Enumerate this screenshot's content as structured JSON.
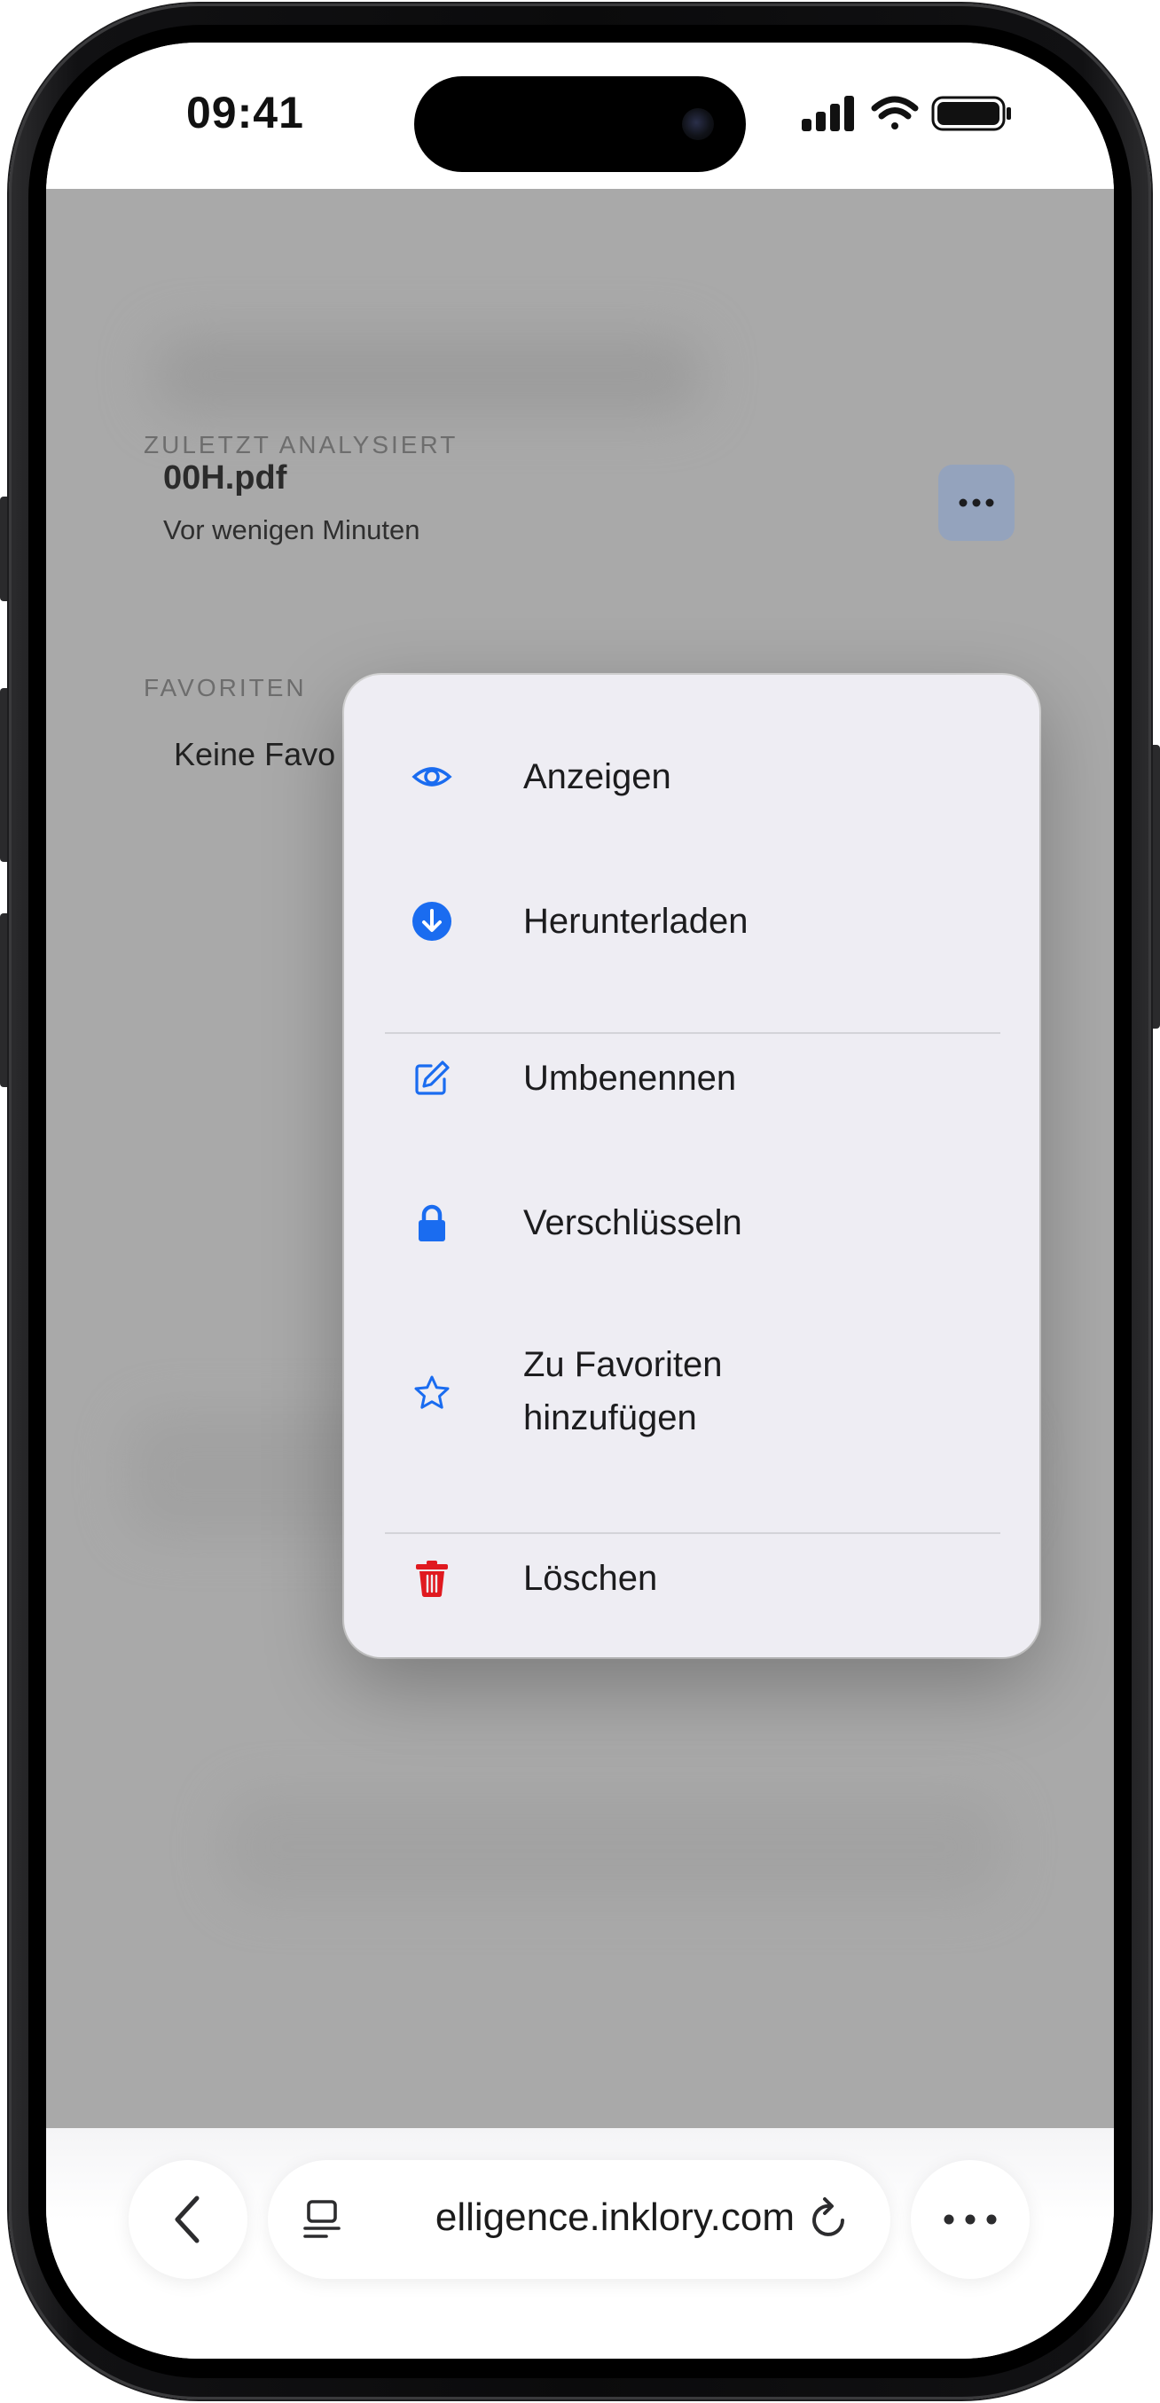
{
  "status_bar": {
    "time": "09:41"
  },
  "page": {
    "recent_section_label": "ZULETZT ANALYSIERT",
    "recent_file": {
      "name": "00H.pdf",
      "time": "Vor wenigen Minuten"
    },
    "favorites_section_label": "FAVORITEN",
    "favorites_empty": "Keine Favo"
  },
  "context_menu": {
    "items": [
      {
        "label": "Anzeigen",
        "icon": "eye-icon"
      },
      {
        "label": "Herunterladen",
        "icon": "download-icon"
      },
      {
        "label": "Umbenennen",
        "icon": "edit-icon"
      },
      {
        "label": "Verschlüsseln",
        "icon": "lock-icon"
      },
      {
        "label": "Zu Favoriten hinzufügen",
        "icon": "star-icon"
      },
      {
        "label": "Löschen",
        "icon": "trash-icon"
      }
    ]
  },
  "browser_bar": {
    "url": "elligence.inklory.com"
  },
  "colors": {
    "accent": "#1a6cf0",
    "danger": "#e0191f",
    "menu_bg": "#eeedf3",
    "overlay": "#a9a9a9"
  }
}
